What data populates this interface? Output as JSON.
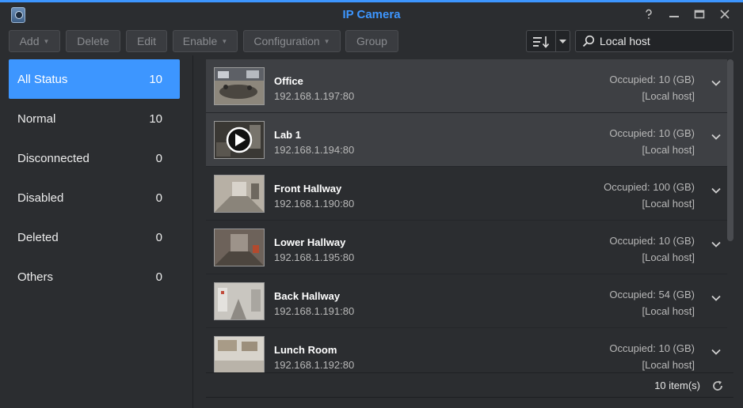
{
  "window": {
    "title": "IP Camera"
  },
  "toolbar": {
    "add_label": "Add",
    "delete_label": "Delete",
    "edit_label": "Edit",
    "enable_label": "Enable",
    "configuration_label": "Configuration",
    "group_label": "Group"
  },
  "search": {
    "value": "Local host"
  },
  "sidebar": {
    "items": [
      {
        "label": "All Status",
        "count": "10"
      },
      {
        "label": "Normal",
        "count": "10"
      },
      {
        "label": "Disconnected",
        "count": "0"
      },
      {
        "label": "Disabled",
        "count": "0"
      },
      {
        "label": "Deleted",
        "count": "0"
      },
      {
        "label": "Others",
        "count": "0"
      }
    ]
  },
  "cameras": [
    {
      "name": "Office",
      "ip": "192.168.1.197:80",
      "occupied": "Occupied: 10 (GB)",
      "host": "[Local host]"
    },
    {
      "name": "Lab 1",
      "ip": "192.168.1.194:80",
      "occupied": "Occupied: 10 (GB)",
      "host": "[Local host]"
    },
    {
      "name": "Front Hallway",
      "ip": "192.168.1.190:80",
      "occupied": "Occupied: 100 (GB)",
      "host": "[Local host]"
    },
    {
      "name": "Lower Hallway",
      "ip": "192.168.1.195:80",
      "occupied": "Occupied: 10 (GB)",
      "host": "[Local host]"
    },
    {
      "name": "Back Hallway",
      "ip": "192.168.1.191:80",
      "occupied": "Occupied: 54 (GB)",
      "host": "[Local host]"
    },
    {
      "name": "Lunch Room",
      "ip": "192.168.1.192:80",
      "occupied": "Occupied: 10 (GB)",
      "host": "[Local host]"
    }
  ],
  "footer": {
    "count": "10 item(s)"
  },
  "colors": {
    "accent": "#3d96ff",
    "background": "#2b2d30",
    "selected_row": "#3e4044"
  }
}
